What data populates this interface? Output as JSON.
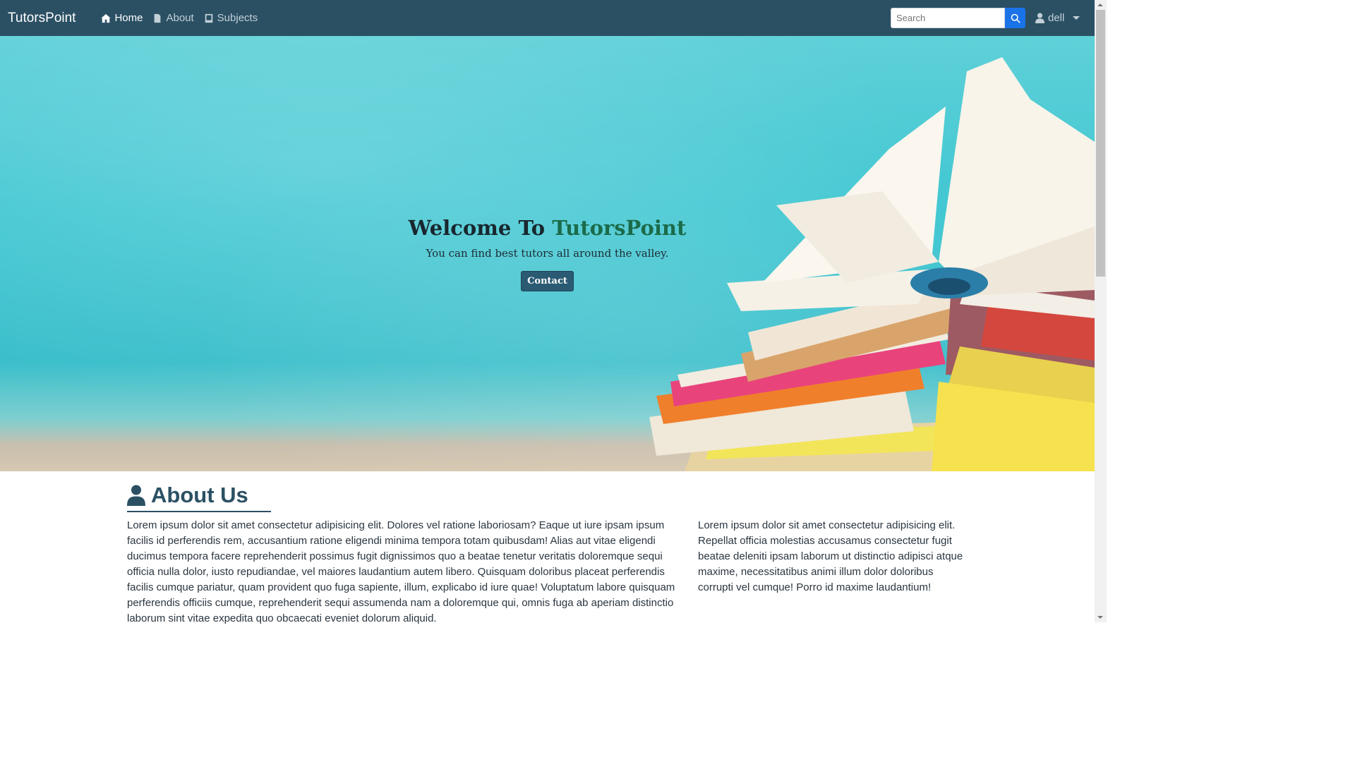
{
  "navbar": {
    "brand": "TutorsPoint",
    "links": [
      {
        "label": "Home",
        "icon": "home-icon",
        "active": true
      },
      {
        "label": "About",
        "icon": "file-icon",
        "active": false
      },
      {
        "label": "Subjects",
        "icon": "book-icon",
        "active": false
      }
    ],
    "search": {
      "placeholder": "Search",
      "value": ""
    },
    "user": {
      "name": "dell",
      "icon": "user-icon"
    }
  },
  "hero": {
    "title_prefix": "Welcome To ",
    "title_accent": "TutorsPoint",
    "subtitle": "You can find best tutors all around the valley.",
    "button_label": "Contact"
  },
  "about": {
    "heading": "About Us",
    "left_text": "Lorem ipsum dolor sit amet consectetur adipisicing elit. Dolores vel ratione laboriosam? Eaque ut iure ipsam ipsum facilis id perferendis rem, accusantium ratione eligendi minima tempora totam quibusdam! Alias aut vitae eligendi ducimus tempora facere reprehenderit possimus fugit dignissimos quo a beatae tenetur veritatis doloremque sequi officia nulla dolor, iusto repudiandae, vel maiores laudantium autem libero. Quisquam doloribus placeat perferendis facilis cumque pariatur, quam provident quo fuga sapiente, illum, explicabo id iure quae! Voluptatum labore quisquam perferendis officiis cumque, reprehenderit sequi assumenda nam a doloremque qui, omnis fuga ab aperiam distinctio laborum sint vitae expedita quo obcaecati eveniet dolorum aliquid.",
    "right_text": "Lorem ipsum dolor sit amet consectetur adipisicing elit. Repellat officia molestias accusamus consectetur fugit beatae deleniti ipsam laborum ut distinctio adipisci atque maxime, necessitatibus animi illum dolor doloribus corrupti vel cumque! Porro id maxime laudantium!"
  },
  "colors": {
    "navbar": "#2b5064",
    "search_button": "#1a73e8",
    "accent_green": "#1b6b4a",
    "contact_button": "#2b5a73"
  }
}
